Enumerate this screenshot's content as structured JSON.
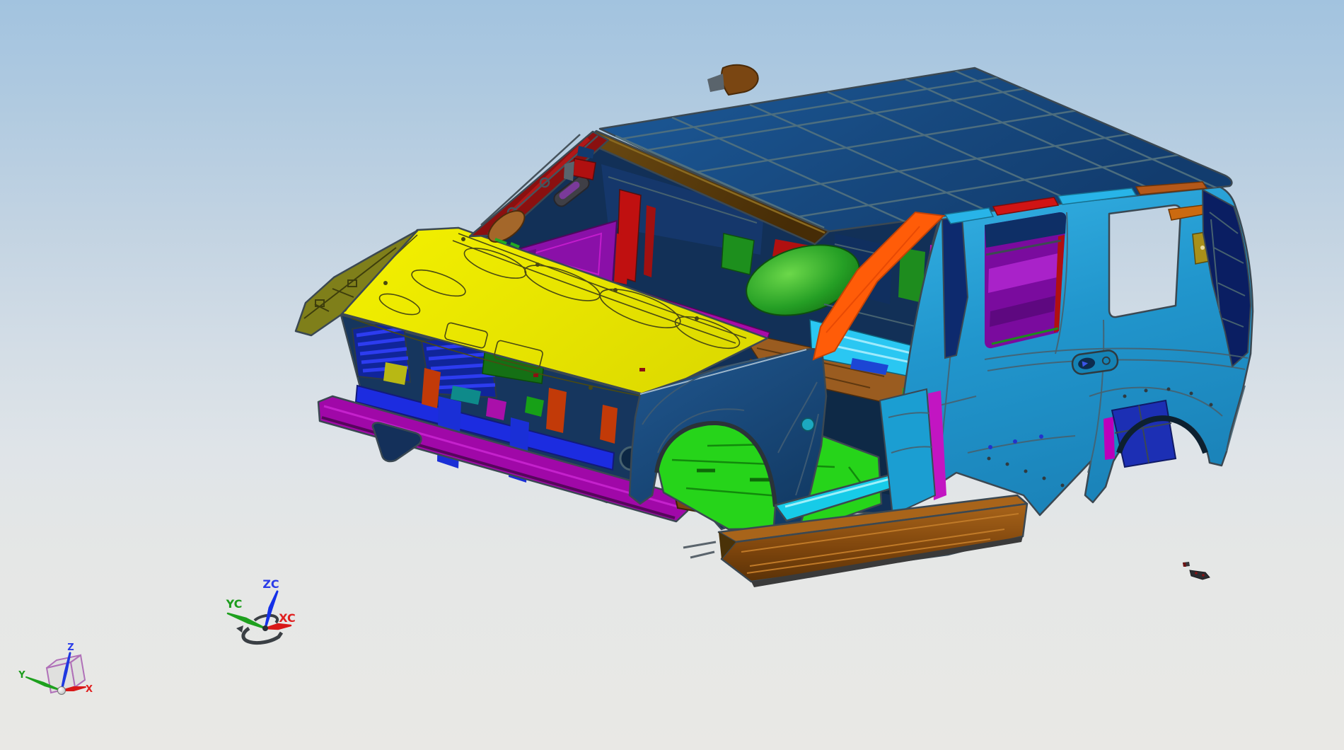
{
  "viewport": {
    "background_top": "#a2c3df",
    "background_middle": "#d3dde6",
    "background_bottom": "#e9e8e5"
  },
  "wcs_triad": {
    "z_label": "ZC",
    "y_label": "YC",
    "x_label": "XC",
    "z_color": "#2a3ce8",
    "y_color": "#1c9c1c",
    "x_color": "#e02020"
  },
  "datum_csys": {
    "z_label": "Z",
    "y_label": "Y",
    "x_label": "X",
    "z_color": "#2a3ce8",
    "y_color": "#1c9c1c",
    "x_color": "#e02020"
  },
  "model": {
    "palette": {
      "roof_blue": "#1a5190",
      "hood_yellow": "#f0ee00",
      "body_cyan": "#249fd6",
      "fender_navy": "#1b4a7f",
      "rocker_brown": "#8a4c10",
      "a_pillar_orange": "#ff5c08",
      "floor_green": "#26d41a",
      "tunnel_green": "#1f9e22",
      "trim_purple": "#8a10a8",
      "trim_magenta": "#a80ba8",
      "accent_red": "#c01010",
      "grille_blue": "#2431e8",
      "floor_cyan": "#2ac7f2",
      "floor_brown": "#9a5c20",
      "olive": "#8f8f12"
    }
  }
}
